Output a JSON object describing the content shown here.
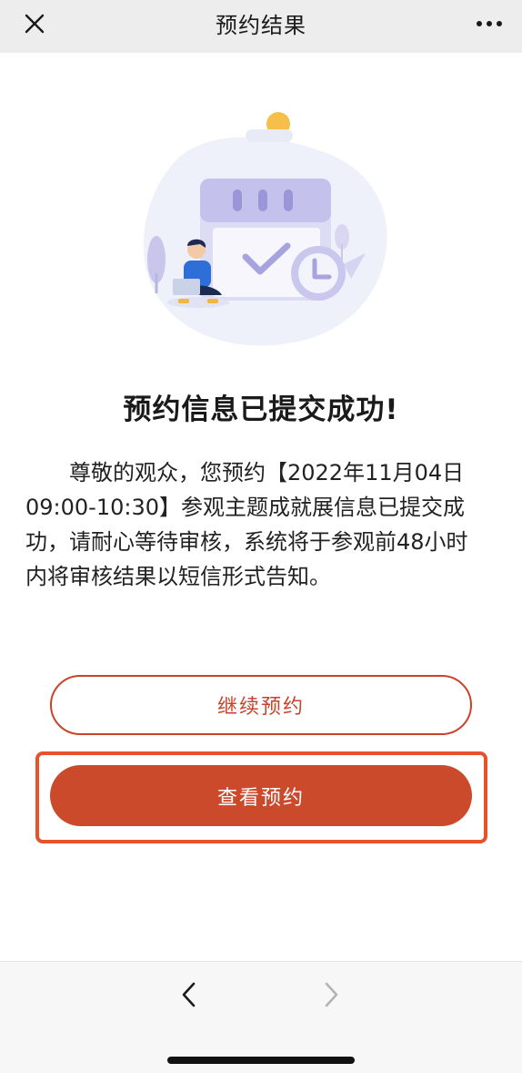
{
  "navbar": {
    "title": "预约结果",
    "close_icon": "close-icon",
    "more_icon": "more-dots-icon"
  },
  "illustration": {
    "icon": "calendar-check-illustration"
  },
  "result": {
    "title": "预约信息已提交成功!",
    "message_lines": [
      "尊敬的观众，您预约【2022年11月04日",
      "09:00-10:30】参观主题成就展信息已提交成",
      "功，请耐心等待审核，系统将于参观前48小时",
      "内将审核结果以短信形式告知。"
    ]
  },
  "buttons": {
    "continue_label": "继续预约",
    "view_label": "查看预约"
  },
  "bottombar": {
    "back_icon": "chevron-left-icon",
    "forward_icon": "chevron-right-icon"
  },
  "colors": {
    "accent": "#cc4a2c",
    "highlight": "#e8522a",
    "navbar_bg": "#ededed"
  }
}
